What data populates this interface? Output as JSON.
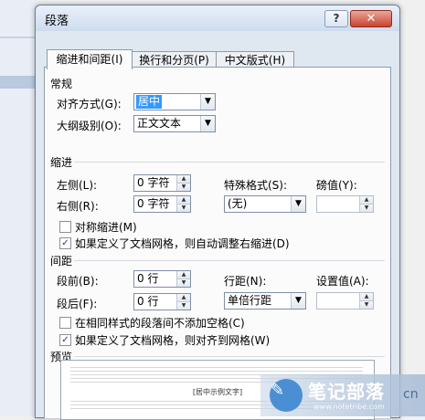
{
  "dialog": {
    "title": "段落",
    "help_label": "?",
    "close_label": "✕"
  },
  "tabs": [
    {
      "label": "缩进和间距(I)",
      "active": true
    },
    {
      "label": "换行和分页(P)",
      "active": false
    },
    {
      "label": "中文版式(H)",
      "active": false
    }
  ],
  "general": {
    "title": "常规",
    "alignment_label": "对齐方式(G):",
    "alignment_value": "居中",
    "outline_label": "大纲级别(O):",
    "outline_value": "正文文本"
  },
  "indent": {
    "title": "缩进",
    "left_label": "左侧(L):",
    "left_value": "0 字符",
    "right_label": "右侧(R):",
    "right_value": "0 字符",
    "special_label": "特殊格式(S):",
    "special_value": "(无)",
    "by_label": "磅值(Y):",
    "by_value": "",
    "mirror_label": "对称缩进(M)",
    "mirror_checked": false,
    "auto_adjust_label": "如果定义了文档网格，则自动调整右缩进(D)",
    "auto_adjust_checked": true
  },
  "spacing": {
    "title": "间距",
    "before_label": "段前(B):",
    "before_value": "0 行",
    "after_label": "段后(F):",
    "after_value": "0 行",
    "line_label": "行距(N):",
    "line_value": "单倍行距",
    "at_label": "设置值(A):",
    "at_value": "",
    "no_space_label": "在相同样式的段落间不添加空格(C)",
    "no_space_checked": false,
    "snap_grid_label": "如果定义了文档网格，则对齐到网格(W)",
    "snap_grid_checked": true
  },
  "preview": {
    "title": "预览",
    "sample_text": "[居中示例文字]"
  },
  "watermark": {
    "title": "笔记部落",
    "url": "www.notetribe.com",
    "side_text": "cn"
  },
  "colors": {
    "selection": "#3399ff",
    "titlebar": "#cfdcee",
    "close": "#c9432f"
  }
}
